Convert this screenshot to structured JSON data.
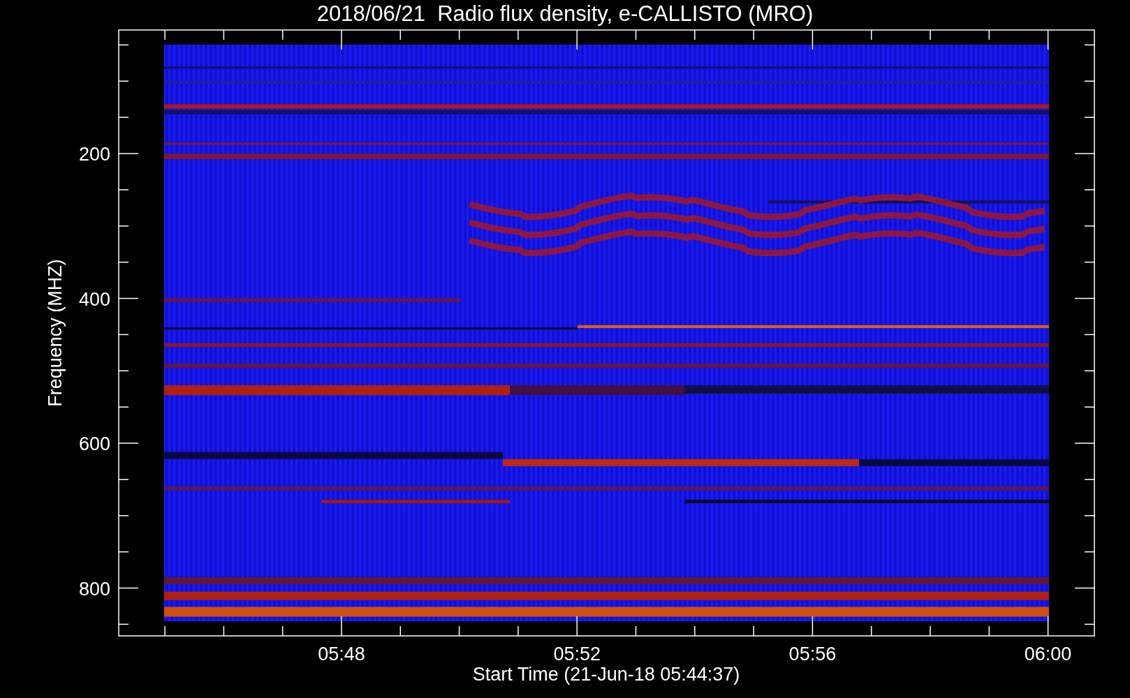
{
  "title": "2018/06/21  Radio flux density, e-CALLISTO (MRO)",
  "y_axis": {
    "label": "Frequency (MHZ)",
    "ticks": [
      "200",
      "400",
      "600",
      "800"
    ]
  },
  "x_axis": {
    "label": "Start Time (21-Jun-18 05:44:37)",
    "ticks": [
      "05:48",
      "05:52",
      "05:56",
      "06:00"
    ]
  }
}
